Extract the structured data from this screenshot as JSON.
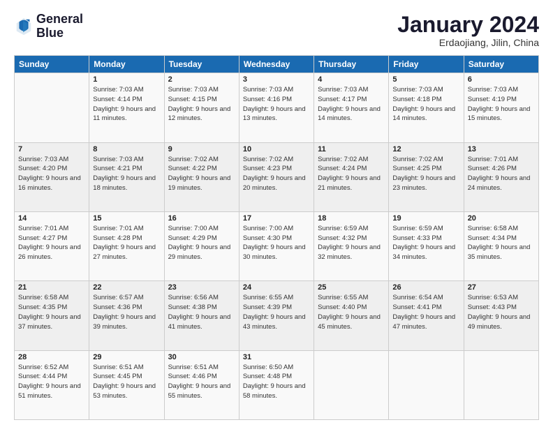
{
  "logo": {
    "line1": "General",
    "line2": "Blue"
  },
  "title": "January 2024",
  "subtitle": "Erdaojiang, Jilin, China",
  "days_of_week": [
    "Sunday",
    "Monday",
    "Tuesday",
    "Wednesday",
    "Thursday",
    "Friday",
    "Saturday"
  ],
  "weeks": [
    [
      {
        "day": "",
        "sunrise": "",
        "sunset": "",
        "daylight": ""
      },
      {
        "day": "1",
        "sunrise": "Sunrise: 7:03 AM",
        "sunset": "Sunset: 4:14 PM",
        "daylight": "Daylight: 9 hours and 11 minutes."
      },
      {
        "day": "2",
        "sunrise": "Sunrise: 7:03 AM",
        "sunset": "Sunset: 4:15 PM",
        "daylight": "Daylight: 9 hours and 12 minutes."
      },
      {
        "day": "3",
        "sunrise": "Sunrise: 7:03 AM",
        "sunset": "Sunset: 4:16 PM",
        "daylight": "Daylight: 9 hours and 13 minutes."
      },
      {
        "day": "4",
        "sunrise": "Sunrise: 7:03 AM",
        "sunset": "Sunset: 4:17 PM",
        "daylight": "Daylight: 9 hours and 14 minutes."
      },
      {
        "day": "5",
        "sunrise": "Sunrise: 7:03 AM",
        "sunset": "Sunset: 4:18 PM",
        "daylight": "Daylight: 9 hours and 14 minutes."
      },
      {
        "day": "6",
        "sunrise": "Sunrise: 7:03 AM",
        "sunset": "Sunset: 4:19 PM",
        "daylight": "Daylight: 9 hours and 15 minutes."
      }
    ],
    [
      {
        "day": "7",
        "sunrise": "Sunrise: 7:03 AM",
        "sunset": "Sunset: 4:20 PM",
        "daylight": "Daylight: 9 hours and 16 minutes."
      },
      {
        "day": "8",
        "sunrise": "Sunrise: 7:03 AM",
        "sunset": "Sunset: 4:21 PM",
        "daylight": "Daylight: 9 hours and 18 minutes."
      },
      {
        "day": "9",
        "sunrise": "Sunrise: 7:02 AM",
        "sunset": "Sunset: 4:22 PM",
        "daylight": "Daylight: 9 hours and 19 minutes."
      },
      {
        "day": "10",
        "sunrise": "Sunrise: 7:02 AM",
        "sunset": "Sunset: 4:23 PM",
        "daylight": "Daylight: 9 hours and 20 minutes."
      },
      {
        "day": "11",
        "sunrise": "Sunrise: 7:02 AM",
        "sunset": "Sunset: 4:24 PM",
        "daylight": "Daylight: 9 hours and 21 minutes."
      },
      {
        "day": "12",
        "sunrise": "Sunrise: 7:02 AM",
        "sunset": "Sunset: 4:25 PM",
        "daylight": "Daylight: 9 hours and 23 minutes."
      },
      {
        "day": "13",
        "sunrise": "Sunrise: 7:01 AM",
        "sunset": "Sunset: 4:26 PM",
        "daylight": "Daylight: 9 hours and 24 minutes."
      }
    ],
    [
      {
        "day": "14",
        "sunrise": "Sunrise: 7:01 AM",
        "sunset": "Sunset: 4:27 PM",
        "daylight": "Daylight: 9 hours and 26 minutes."
      },
      {
        "day": "15",
        "sunrise": "Sunrise: 7:01 AM",
        "sunset": "Sunset: 4:28 PM",
        "daylight": "Daylight: 9 hours and 27 minutes."
      },
      {
        "day": "16",
        "sunrise": "Sunrise: 7:00 AM",
        "sunset": "Sunset: 4:29 PM",
        "daylight": "Daylight: 9 hours and 29 minutes."
      },
      {
        "day": "17",
        "sunrise": "Sunrise: 7:00 AM",
        "sunset": "Sunset: 4:30 PM",
        "daylight": "Daylight: 9 hours and 30 minutes."
      },
      {
        "day": "18",
        "sunrise": "Sunrise: 6:59 AM",
        "sunset": "Sunset: 4:32 PM",
        "daylight": "Daylight: 9 hours and 32 minutes."
      },
      {
        "day": "19",
        "sunrise": "Sunrise: 6:59 AM",
        "sunset": "Sunset: 4:33 PM",
        "daylight": "Daylight: 9 hours and 34 minutes."
      },
      {
        "day": "20",
        "sunrise": "Sunrise: 6:58 AM",
        "sunset": "Sunset: 4:34 PM",
        "daylight": "Daylight: 9 hours and 35 minutes."
      }
    ],
    [
      {
        "day": "21",
        "sunrise": "Sunrise: 6:58 AM",
        "sunset": "Sunset: 4:35 PM",
        "daylight": "Daylight: 9 hours and 37 minutes."
      },
      {
        "day": "22",
        "sunrise": "Sunrise: 6:57 AM",
        "sunset": "Sunset: 4:36 PM",
        "daylight": "Daylight: 9 hours and 39 minutes."
      },
      {
        "day": "23",
        "sunrise": "Sunrise: 6:56 AM",
        "sunset": "Sunset: 4:38 PM",
        "daylight": "Daylight: 9 hours and 41 minutes."
      },
      {
        "day": "24",
        "sunrise": "Sunrise: 6:55 AM",
        "sunset": "Sunset: 4:39 PM",
        "daylight": "Daylight: 9 hours and 43 minutes."
      },
      {
        "day": "25",
        "sunrise": "Sunrise: 6:55 AM",
        "sunset": "Sunset: 4:40 PM",
        "daylight": "Daylight: 9 hours and 45 minutes."
      },
      {
        "day": "26",
        "sunrise": "Sunrise: 6:54 AM",
        "sunset": "Sunset: 4:41 PM",
        "daylight": "Daylight: 9 hours and 47 minutes."
      },
      {
        "day": "27",
        "sunrise": "Sunrise: 6:53 AM",
        "sunset": "Sunset: 4:43 PM",
        "daylight": "Daylight: 9 hours and 49 minutes."
      }
    ],
    [
      {
        "day": "28",
        "sunrise": "Sunrise: 6:52 AM",
        "sunset": "Sunset: 4:44 PM",
        "daylight": "Daylight: 9 hours and 51 minutes."
      },
      {
        "day": "29",
        "sunrise": "Sunrise: 6:51 AM",
        "sunset": "Sunset: 4:45 PM",
        "daylight": "Daylight: 9 hours and 53 minutes."
      },
      {
        "day": "30",
        "sunrise": "Sunrise: 6:51 AM",
        "sunset": "Sunset: 4:46 PM",
        "daylight": "Daylight: 9 hours and 55 minutes."
      },
      {
        "day": "31",
        "sunrise": "Sunrise: 6:50 AM",
        "sunset": "Sunset: 4:48 PM",
        "daylight": "Daylight: 9 hours and 58 minutes."
      },
      {
        "day": "",
        "sunrise": "",
        "sunset": "",
        "daylight": ""
      },
      {
        "day": "",
        "sunrise": "",
        "sunset": "",
        "daylight": ""
      },
      {
        "day": "",
        "sunrise": "",
        "sunset": "",
        "daylight": ""
      }
    ]
  ]
}
